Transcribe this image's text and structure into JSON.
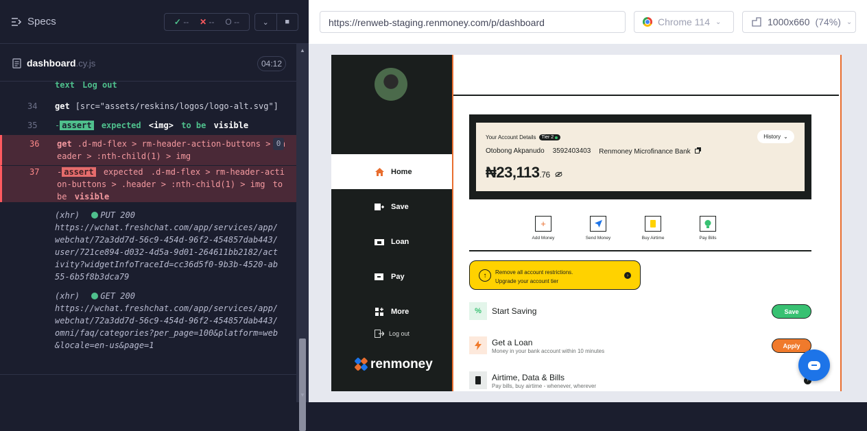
{
  "runner": {
    "specs_label": "Specs",
    "stats": {
      "passed": "--",
      "failed": "--",
      "pending": "--"
    },
    "file_name": "dashboard",
    "file_ext": ".cy.js",
    "duration": "04:12",
    "log": [
      {
        "num": "",
        "cmd": "text",
        "detail": "Log out"
      },
      {
        "num": "34",
        "cmd": "get",
        "detail": "[src=\"assets/reskins/logos/logo-alt.svg\"]"
      },
      {
        "num": "35",
        "assert": "assert",
        "text1": "expected",
        "strong1": "<img>",
        "text2": "to be",
        "strong2": "visible"
      },
      {
        "num": "36",
        "cmd": "get",
        "detail": ".d-md-flex > rm-header-action-buttons > .header > :nth-child(1) > img",
        "badge": "0"
      },
      {
        "num": "37",
        "assert": "assert",
        "text1": "expected",
        "detail": ".d-md-flex > rm-header-action-buttons > .header > :nth-child(1) > img",
        "text2": "to be",
        "strong2": "visible"
      },
      {
        "xhr": "(xhr)",
        "method": "PUT 200",
        "url": "https://wchat.freshchat.com/app/services/app/webchat/72a3dd7d-56c9-454d-96f2-454857dab443/user/721ce894-d032-4d5a-9d01-264611bb2182/activity?widgetInfoTraceId=cc36d5f0-9b3b-4520-ab55-6b5f8b3dca79"
      },
      {
        "xhr": "(xhr)",
        "method": "GET 200",
        "url": "https://wchat.freshchat.com/app/services/app/webchat/72a3dd7d-56c9-454d-96f2-454857dab443/omni/faq/categories?per_page=100&platform=web&locale=en-us&page=1"
      }
    ]
  },
  "browser_bar": {
    "url": "https://renweb-staging.renmoney.com/p/dashboard",
    "browser": "Chrome 114",
    "viewport": "1000x660",
    "zoom": "(74%)"
  },
  "app": {
    "nav": [
      {
        "label": "Home",
        "icon": "home-icon",
        "active": true
      },
      {
        "label": "Save",
        "icon": "save-icon"
      },
      {
        "label": "Loan",
        "icon": "loan-icon"
      },
      {
        "label": "Pay",
        "icon": "pay-icon"
      },
      {
        "label": "More",
        "icon": "more-icon"
      }
    ],
    "logout": "Log out",
    "logo": "renmoney",
    "account": {
      "title": "Your Account Details",
      "tier": "Tier 2",
      "name": "Otobong Akpanudo",
      "number": "3592403403",
      "bank": "Renmoney Microfinance Bank",
      "balance_main": "₦23,113",
      "balance_cents": ".76",
      "history": "History"
    },
    "actions": [
      {
        "label": "Add Money",
        "icon": "plus-icon",
        "color": "#e86d2e"
      },
      {
        "label": "Send Money",
        "icon": "send-icon",
        "color": "#1d74e8"
      },
      {
        "label": "Buy Airtime",
        "icon": "phone-icon",
        "color": "#ffd200"
      },
      {
        "label": "Pay Bills",
        "icon": "bulb-icon",
        "color": "#38c172"
      }
    ],
    "promo": {
      "line1": "Remove all account restrictions.",
      "line2": "Upgrade your account tier"
    },
    "services": [
      {
        "title": "Start Saving",
        "subtitle": "",
        "button": "Save",
        "button_color": "#38c172",
        "icon_bg": "#e3f5ea"
      },
      {
        "title": "Get a Loan",
        "subtitle": "Money in your bank account within 10 minutes",
        "button": "Apply",
        "button_color": "#f07a2c",
        "icon_bg": "#fde9dc"
      },
      {
        "title": "Airtime, Data & Bills",
        "subtitle": "Pay bills, buy airtime - whenever, wherever",
        "button": "",
        "icon_bg": "#e8ebea"
      }
    ]
  }
}
